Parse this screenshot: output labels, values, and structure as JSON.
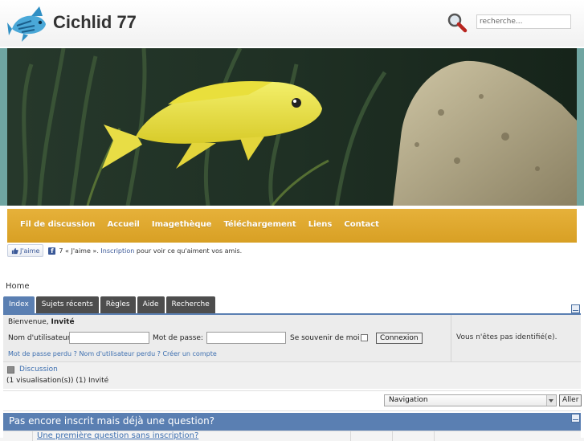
{
  "header": {
    "site_title": "Cichlid 77",
    "search_placeholder": "recherche..."
  },
  "nav": {
    "items": [
      "Fil de discussion",
      "Accueil",
      "Imagethèque",
      "Téléchargement",
      "Liens",
      "Contact"
    ]
  },
  "facebook": {
    "like_label": "J'aime",
    "text_before": "7 « J'aime ».",
    "signup_link": "Inscription",
    "text_after": "pour voir ce qu'aiment vos amis."
  },
  "breadcrumb": "Home",
  "tabs": [
    "Index",
    "Sujets récents",
    "Règles",
    "Aide",
    "Recherche"
  ],
  "login": {
    "welcome_prefix": "Bienvenue,",
    "welcome_user": "Invité",
    "username_label": "Nom d'utilisateur",
    "password_label": "Mot de passe:",
    "remember_label": "Se souvenir de moi",
    "login_button": "Connexion",
    "links": [
      "Mot de passe perdu ?",
      "Nom d'utilisateur perdu ?",
      "Créer un compte"
    ],
    "not_identified": "Vous n'êtes pas identifié(e)."
  },
  "discussion": {
    "link": "Discussion",
    "visits": "(1 visualisation(s)) (1) Invité"
  },
  "navigation": {
    "selected": "Navigation",
    "go_button": "Aller"
  },
  "question_section": {
    "title": "Pas encore inscrit mais déjà une question?",
    "first_link": "Une première question sans inscription?"
  },
  "colors": {
    "nav_bar": "#d8a024",
    "tab_active": "#5a7fb2",
    "link": "#3d6fb0"
  }
}
